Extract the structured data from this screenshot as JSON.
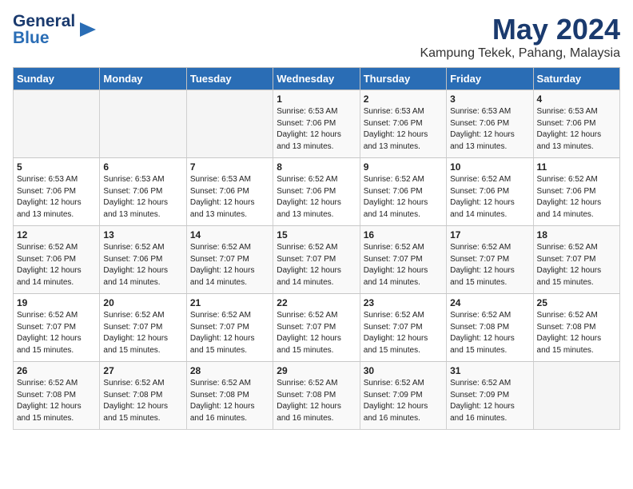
{
  "header": {
    "logo_line1": "General",
    "logo_line2": "Blue",
    "month_year": "May 2024",
    "location": "Kampung Tekek, Pahang, Malaysia"
  },
  "days_of_week": [
    "Sunday",
    "Monday",
    "Tuesday",
    "Wednesday",
    "Thursday",
    "Friday",
    "Saturday"
  ],
  "weeks": [
    [
      {
        "day": "",
        "info": ""
      },
      {
        "day": "",
        "info": ""
      },
      {
        "day": "",
        "info": ""
      },
      {
        "day": "1",
        "info": "Sunrise: 6:53 AM\nSunset: 7:06 PM\nDaylight: 12 hours\nand 13 minutes."
      },
      {
        "day": "2",
        "info": "Sunrise: 6:53 AM\nSunset: 7:06 PM\nDaylight: 12 hours\nand 13 minutes."
      },
      {
        "day": "3",
        "info": "Sunrise: 6:53 AM\nSunset: 7:06 PM\nDaylight: 12 hours\nand 13 minutes."
      },
      {
        "day": "4",
        "info": "Sunrise: 6:53 AM\nSunset: 7:06 PM\nDaylight: 12 hours\nand 13 minutes."
      }
    ],
    [
      {
        "day": "5",
        "info": "Sunrise: 6:53 AM\nSunset: 7:06 PM\nDaylight: 12 hours\nand 13 minutes."
      },
      {
        "day": "6",
        "info": "Sunrise: 6:53 AM\nSunset: 7:06 PM\nDaylight: 12 hours\nand 13 minutes."
      },
      {
        "day": "7",
        "info": "Sunrise: 6:53 AM\nSunset: 7:06 PM\nDaylight: 12 hours\nand 13 minutes."
      },
      {
        "day": "8",
        "info": "Sunrise: 6:52 AM\nSunset: 7:06 PM\nDaylight: 12 hours\nand 13 minutes."
      },
      {
        "day": "9",
        "info": "Sunrise: 6:52 AM\nSunset: 7:06 PM\nDaylight: 12 hours\nand 14 minutes."
      },
      {
        "day": "10",
        "info": "Sunrise: 6:52 AM\nSunset: 7:06 PM\nDaylight: 12 hours\nand 14 minutes."
      },
      {
        "day": "11",
        "info": "Sunrise: 6:52 AM\nSunset: 7:06 PM\nDaylight: 12 hours\nand 14 minutes."
      }
    ],
    [
      {
        "day": "12",
        "info": "Sunrise: 6:52 AM\nSunset: 7:06 PM\nDaylight: 12 hours\nand 14 minutes."
      },
      {
        "day": "13",
        "info": "Sunrise: 6:52 AM\nSunset: 7:06 PM\nDaylight: 12 hours\nand 14 minutes."
      },
      {
        "day": "14",
        "info": "Sunrise: 6:52 AM\nSunset: 7:07 PM\nDaylight: 12 hours\nand 14 minutes."
      },
      {
        "day": "15",
        "info": "Sunrise: 6:52 AM\nSunset: 7:07 PM\nDaylight: 12 hours\nand 14 minutes."
      },
      {
        "day": "16",
        "info": "Sunrise: 6:52 AM\nSunset: 7:07 PM\nDaylight: 12 hours\nand 14 minutes."
      },
      {
        "day": "17",
        "info": "Sunrise: 6:52 AM\nSunset: 7:07 PM\nDaylight: 12 hours\nand 15 minutes."
      },
      {
        "day": "18",
        "info": "Sunrise: 6:52 AM\nSunset: 7:07 PM\nDaylight: 12 hours\nand 15 minutes."
      }
    ],
    [
      {
        "day": "19",
        "info": "Sunrise: 6:52 AM\nSunset: 7:07 PM\nDaylight: 12 hours\nand 15 minutes."
      },
      {
        "day": "20",
        "info": "Sunrise: 6:52 AM\nSunset: 7:07 PM\nDaylight: 12 hours\nand 15 minutes."
      },
      {
        "day": "21",
        "info": "Sunrise: 6:52 AM\nSunset: 7:07 PM\nDaylight: 12 hours\nand 15 minutes."
      },
      {
        "day": "22",
        "info": "Sunrise: 6:52 AM\nSunset: 7:07 PM\nDaylight: 12 hours\nand 15 minutes."
      },
      {
        "day": "23",
        "info": "Sunrise: 6:52 AM\nSunset: 7:07 PM\nDaylight: 12 hours\nand 15 minutes."
      },
      {
        "day": "24",
        "info": "Sunrise: 6:52 AM\nSunset: 7:08 PM\nDaylight: 12 hours\nand 15 minutes."
      },
      {
        "day": "25",
        "info": "Sunrise: 6:52 AM\nSunset: 7:08 PM\nDaylight: 12 hours\nand 15 minutes."
      }
    ],
    [
      {
        "day": "26",
        "info": "Sunrise: 6:52 AM\nSunset: 7:08 PM\nDaylight: 12 hours\nand 15 minutes."
      },
      {
        "day": "27",
        "info": "Sunrise: 6:52 AM\nSunset: 7:08 PM\nDaylight: 12 hours\nand 15 minutes."
      },
      {
        "day": "28",
        "info": "Sunrise: 6:52 AM\nSunset: 7:08 PM\nDaylight: 12 hours\nand 16 minutes."
      },
      {
        "day": "29",
        "info": "Sunrise: 6:52 AM\nSunset: 7:08 PM\nDaylight: 12 hours\nand 16 minutes."
      },
      {
        "day": "30",
        "info": "Sunrise: 6:52 AM\nSunset: 7:09 PM\nDaylight: 12 hours\nand 16 minutes."
      },
      {
        "day": "31",
        "info": "Sunrise: 6:52 AM\nSunset: 7:09 PM\nDaylight: 12 hours\nand 16 minutes."
      },
      {
        "day": "",
        "info": ""
      }
    ]
  ]
}
